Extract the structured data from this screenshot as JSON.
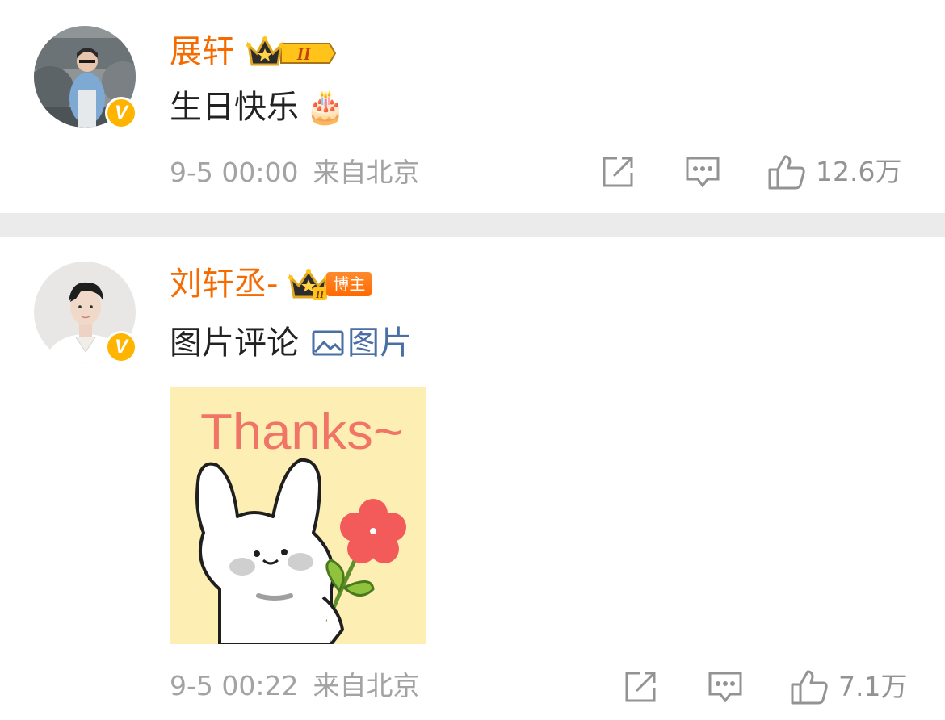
{
  "comments": [
    {
      "username": "展轩",
      "level_badge": "II",
      "text": "生日快乐",
      "emoji": "🎂",
      "time": "9-5 00:00",
      "source": "来自北京",
      "like_count": "12.6万"
    },
    {
      "username": "刘轩丞-",
      "level_badge": "II",
      "role_tag": "博主",
      "text": "图片评论",
      "image_link_label": "图片",
      "sticker_text": "Thanks~",
      "time": "9-5 00:22",
      "source": "来自北京",
      "like_count": "7.1万"
    }
  ],
  "verified_mark": "V",
  "icons": [
    "share-icon",
    "comment-icon",
    "like-icon",
    "crown-icon",
    "image-icon"
  ],
  "colors": {
    "username": "#f56b00",
    "meta_text": "#a3a3a3",
    "link": "#4a6fa5",
    "verified_badge": "#ffb400",
    "divider": "#ebebeb"
  }
}
